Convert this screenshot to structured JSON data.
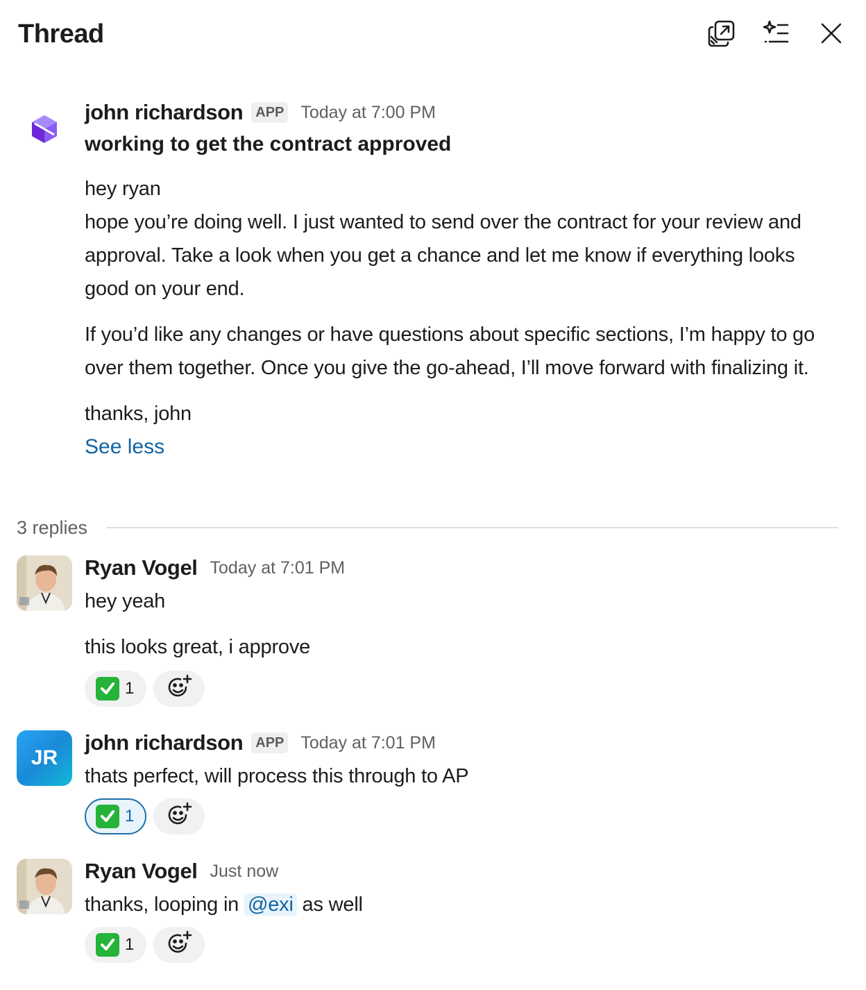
{
  "header": {
    "title": "Thread",
    "icons": [
      "open-in-new-window-icon",
      "ai-summary-icon",
      "close-icon"
    ]
  },
  "colors": {
    "link": "#1264a3",
    "meta_gray": "#616061",
    "reaction_bg": "#f1f1f1",
    "reaction_active_border": "#1d6fa8",
    "check_green": "#25b339"
  },
  "parent_message": {
    "author": "john richardson",
    "badge": "APP",
    "time": "Today at 7:00 PM",
    "subject": "working to get the contract approved",
    "greeting": "hey ryan",
    "paragraph1": "hope you’re doing well. I just wanted to send over the contract for your review and approval. Take a look when you get a chance and let me know if everything looks good on your end.",
    "paragraph2": "If you’d like any changes or have questions about specific sections, I’m happy to go over them together. Once you give the go-ahead, I’ll move forward with finalizing it.",
    "signoff": "thanks, john",
    "see_less": "See less"
  },
  "replies_label": "3 replies",
  "replies": [
    {
      "author": "Ryan Vogel",
      "time": "Today at 7:01 PM",
      "line1": "hey yeah",
      "line2": "this looks great, i approve",
      "reaction": {
        "emoji": "white-check-mark",
        "count": "1"
      }
    },
    {
      "author": "john richardson",
      "initials": "JR",
      "badge": "APP",
      "time": "Today at 7:01 PM",
      "text": "thats perfect, will process this through to AP",
      "reaction": {
        "emoji": "white-check-mark",
        "count": "1"
      }
    },
    {
      "author": "Ryan Vogel",
      "time": "Just now",
      "text_before": "thanks, looping in ",
      "mention": "@exi",
      "text_after": " as well",
      "reaction": {
        "emoji": "white-check-mark",
        "count": "1"
      }
    }
  ]
}
